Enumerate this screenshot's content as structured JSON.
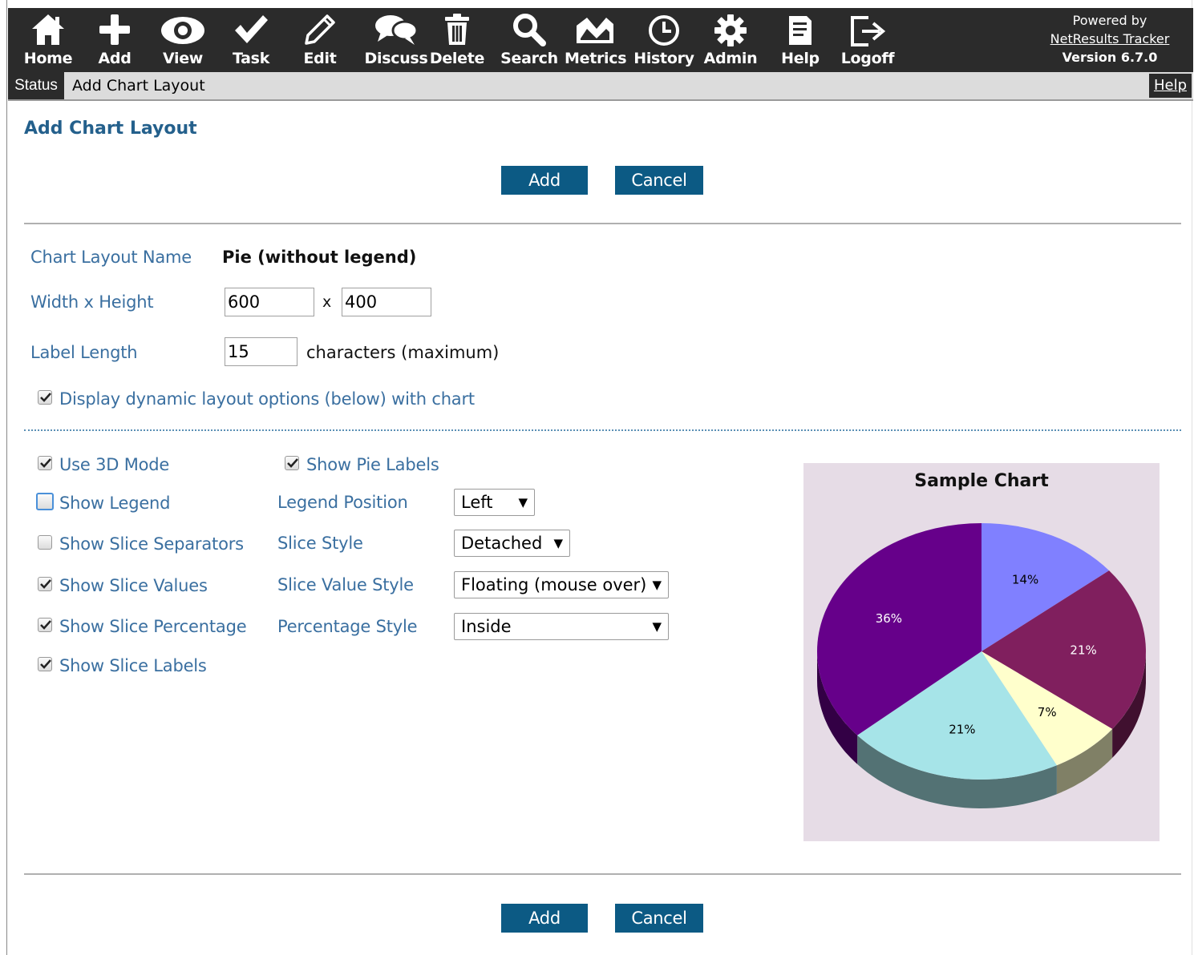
{
  "nav": {
    "items": [
      {
        "label": "Home",
        "icon": "home-icon"
      },
      {
        "label": "Add",
        "icon": "plus-icon"
      },
      {
        "label": "View",
        "icon": "eye-icon"
      },
      {
        "label": "Task",
        "icon": "checkmark-icon"
      },
      {
        "label": "Edit",
        "icon": "pencil-icon"
      },
      {
        "label": "Discuss",
        "icon": "speech-bubbles-icon"
      },
      {
        "label": "Delete",
        "icon": "trash-icon"
      },
      {
        "label": "Search",
        "icon": "magnifier-icon"
      },
      {
        "label": "Metrics",
        "icon": "chart-line-icon"
      },
      {
        "label": "History",
        "icon": "clock-icon"
      },
      {
        "label": "Admin",
        "icon": "gear-icon"
      },
      {
        "label": "Help",
        "icon": "document-icon"
      },
      {
        "label": "Logoff",
        "icon": "logoff-icon"
      }
    ],
    "powered_by": "Powered by",
    "product_link": "NetResults Tracker",
    "version": "Version 6.7.0"
  },
  "statusbar": {
    "tab": "Status",
    "title": "Add Chart Layout",
    "help": "Help"
  },
  "page": {
    "title": "Add Chart Layout",
    "add_label": "Add",
    "cancel_label": "Cancel"
  },
  "form": {
    "layout_name_label": "Chart Layout Name",
    "layout_name_value": "Pie (without legend)",
    "size_label": "Width x Height",
    "width": "600",
    "size_sep": "x",
    "height": "400",
    "label_length_label": "Label Length",
    "label_length": "15",
    "label_length_suffix": "characters (maximum)",
    "dynamic_options_label": "Display dynamic layout options (below) with chart",
    "dynamic_options_checked": true
  },
  "options": {
    "use_3d": {
      "label": "Use 3D Mode",
      "checked": true
    },
    "show_pie_labels": {
      "label": "Show Pie Labels",
      "checked": true
    },
    "show_legend": {
      "label": "Show Legend",
      "checked": false
    },
    "show_slice_separators": {
      "label": "Show Slice Separators",
      "checked": false
    },
    "show_slice_values": {
      "label": "Show Slice Values",
      "checked": true
    },
    "show_slice_percentage": {
      "label": "Show Slice Percentage",
      "checked": true
    },
    "show_slice_labels": {
      "label": "Show Slice Labels",
      "checked": true
    },
    "legend_position": {
      "label": "Legend Position",
      "value": "Left"
    },
    "slice_style": {
      "label": "Slice Style",
      "value": "Detached"
    },
    "slice_value_style": {
      "label": "Slice Value Style",
      "value": "Floating (mouse over)"
    },
    "percentage_style": {
      "label": "Percentage Style",
      "value": "Inside"
    }
  },
  "chart_data": {
    "type": "pie",
    "title": "Sample Chart",
    "three_d": true,
    "slices": [
      {
        "value": 14,
        "label": "14%",
        "color": "#8080ff"
      },
      {
        "value": 21,
        "label": "21%",
        "color": "#801f5e"
      },
      {
        "value": 7,
        "label": "7%",
        "color": "#ffffcc"
      },
      {
        "value": 21,
        "label": "21%",
        "color": "#a6e4e8"
      },
      {
        "value": 36,
        "label": "36%",
        "color": "#66008a"
      }
    ],
    "background": "#e6dce6"
  },
  "colors": {
    "nav_bg": "#2b2b2b",
    "button_bg": "#0c5a84",
    "label_blue": "#3a6fa0",
    "title_blue": "#24608c"
  }
}
